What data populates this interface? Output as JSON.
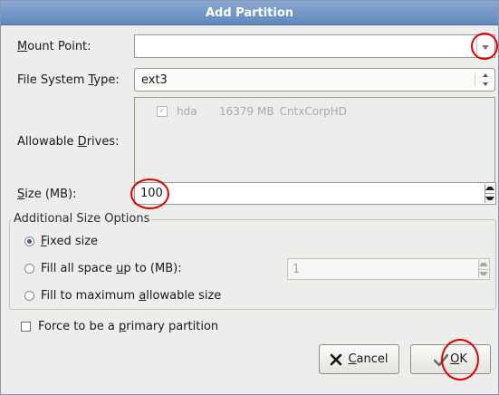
{
  "window": {
    "title": "Add Partition"
  },
  "mount_point": {
    "label_prefix": "",
    "mnemonic": "M",
    "label_rest": "ount Point:",
    "value": ""
  },
  "fs_type": {
    "label_prefix": "File System ",
    "mnemonic": "T",
    "label_rest": "ype:",
    "value": "ext3"
  },
  "drives": {
    "label_prefix": "Allowable ",
    "mnemonic": "D",
    "label_rest": "rives:",
    "items": [
      {
        "name": "hda",
        "size": "16379 MB",
        "model": "CntxCorpHD",
        "checked": true
      }
    ]
  },
  "size": {
    "label_prefix": "",
    "mnemonic": "S",
    "label_rest": "ize (MB):",
    "value": "100"
  },
  "size_options": {
    "title": "Additional Size Options",
    "fixed": {
      "mnemonic": "F",
      "label_rest": "ixed size",
      "selected": true
    },
    "fill_upto": {
      "label_prefix": "Fill all space ",
      "mnemonic": "u",
      "label_rest": "p to (MB):",
      "value": "1",
      "selected": false
    },
    "fill_max": {
      "label_prefix": "Fill to maximum ",
      "mnemonic": "a",
      "label_rest": "llowable size",
      "selected": false
    }
  },
  "primary": {
    "label_prefix": "Force to be a ",
    "mnemonic": "p",
    "label_rest": "rimary partition",
    "checked": false
  },
  "buttons": {
    "cancel": {
      "mnemonic": "C",
      "label_rest": "ancel"
    },
    "ok": {
      "mnemonic": "O",
      "label_rest": "K"
    }
  }
}
